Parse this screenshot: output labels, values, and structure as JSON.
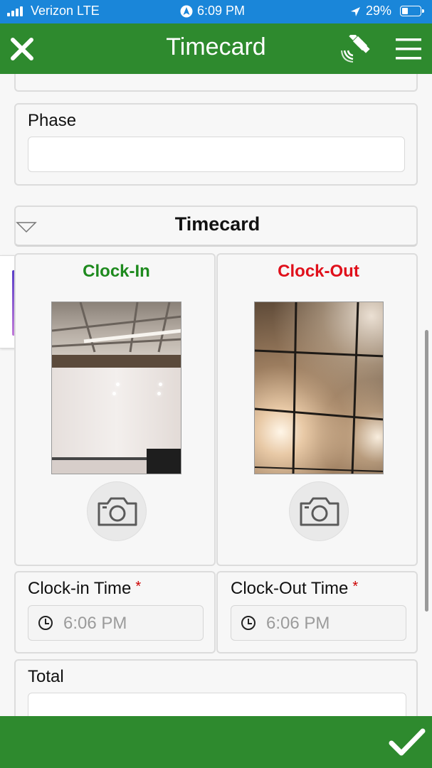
{
  "status_bar": {
    "carrier": "Verizon LTE",
    "time": "6:09 PM",
    "battery": "29%"
  },
  "header": {
    "title": "Timecard",
    "close_icon": "close-icon",
    "gps_icon": "satellite-icon",
    "menu_icon": "hamburger-menu-icon"
  },
  "phase": {
    "label": "Phase",
    "value": ""
  },
  "timecard_section": {
    "title": "Timecard",
    "clock_in": {
      "label": "Clock-In",
      "color": "#1e8a1e"
    },
    "clock_out": {
      "label": "Clock-Out",
      "color": "#e0101b"
    }
  },
  "clock_in_time": {
    "label": "Clock-in Time",
    "required_mark": "*",
    "value": "6:06 PM"
  },
  "clock_out_time": {
    "label": "Clock-Out Time",
    "required_mark": "*",
    "value": "6:06 PM"
  },
  "total": {
    "label": "Total",
    "value": ""
  },
  "footer": {
    "submit_icon": "checkmark-icon"
  },
  "colors": {
    "status_bar": "#1a86d9",
    "header": "#2e8a2e",
    "footer": "#2e8a2e"
  }
}
